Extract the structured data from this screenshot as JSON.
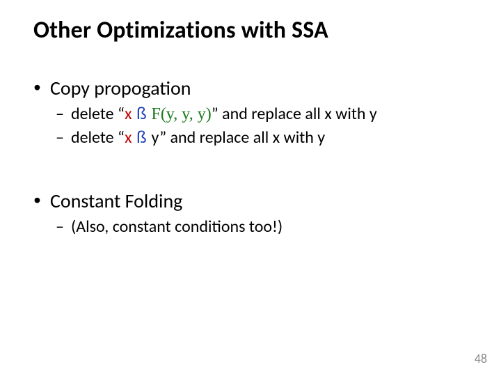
{
  "title": "Other Optimizations with SSA",
  "items": [
    {
      "label": "Copy propogation",
      "sub": [
        {
          "pre": "delete “",
          "x": "x",
          "arrow": " ß ",
          "rhs": "F(y, y, y)",
          "rhs_style": "phi",
          "post": "” and replace all x with y"
        },
        {
          "pre": "delete “",
          "x": "x",
          "arrow": " ß ",
          "rhs": " y",
          "rhs_style": "plain",
          "post": "” and replace all x with y"
        }
      ]
    },
    {
      "label": "Constant Folding",
      "sub": [
        {
          "text": "(Also, constant conditions too!)"
        }
      ]
    }
  ],
  "page_number": "48"
}
